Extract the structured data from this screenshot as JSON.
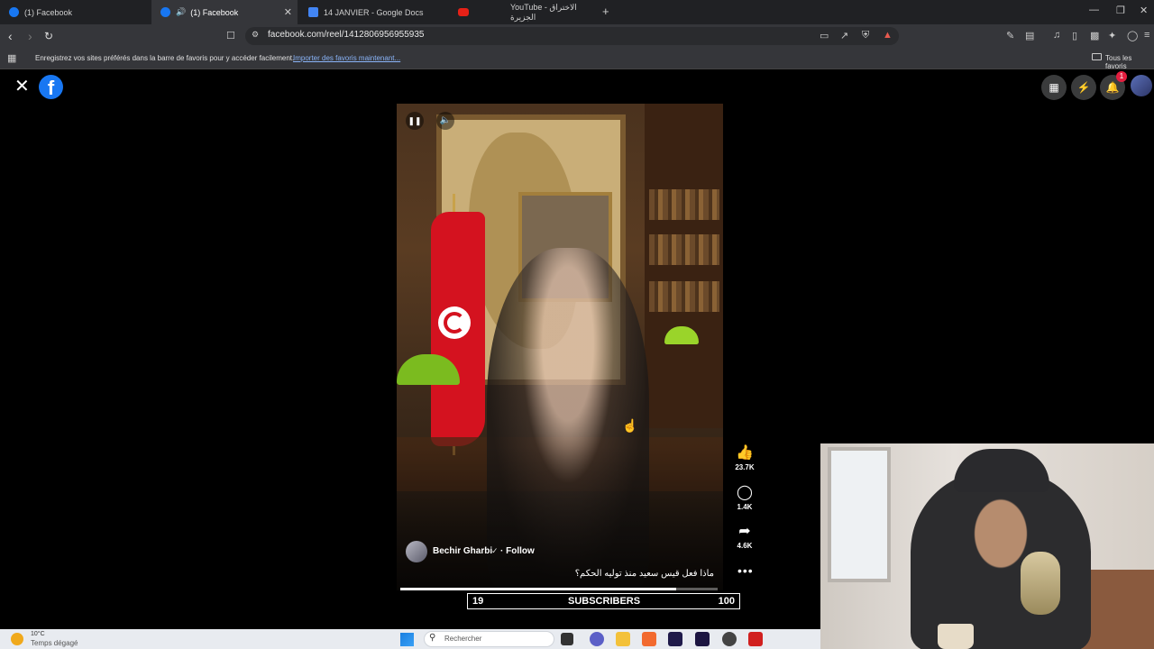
{
  "browser": {
    "tabs": [
      {
        "title": "(1) Facebook",
        "icon": "facebook-icon",
        "active": false
      },
      {
        "title": "(1) Facebook",
        "icon": "facebook-icon",
        "active": true
      },
      {
        "title": "14 JANVIER - Google Docs",
        "icon": "google-docs-icon",
        "active": false
      },
      {
        "title": "YouTube - الاختراق الجزيرة",
        "icon": "youtube-icon",
        "active": false
      }
    ],
    "new_tab": "+",
    "url": "facebook.com/reel/1412806956955935",
    "bookmarks_bar": {
      "message": "Enregistrez vos sites préférés dans la barre de favoris pour y accéder facilement.",
      "import_link": "Importer des favoris maintenant...",
      "all_bookmarks": "Tous les favoris"
    }
  },
  "facebook": {
    "notification_count": "1",
    "reel": {
      "author": "Bechir Gharbi",
      "follow_label": "· Follow",
      "caption": "ماذا فعل قيس سعيد منذ توليه الحكم؟",
      "likes": "23.7K",
      "comments": "1.4K",
      "shares": "4.6K",
      "progress": 0.87
    }
  },
  "overlay": {
    "left_value": "19",
    "label": "SUBSCRIBERS",
    "right_value": "100"
  },
  "taskbar": {
    "temperature": "10°C",
    "weather": "Temps dégagé",
    "search_placeholder": "Rechercher"
  },
  "colors": {
    "facebook_blue": "#1877f2",
    "notification_red": "#e41e3f",
    "chrome_dark": "#202124"
  }
}
